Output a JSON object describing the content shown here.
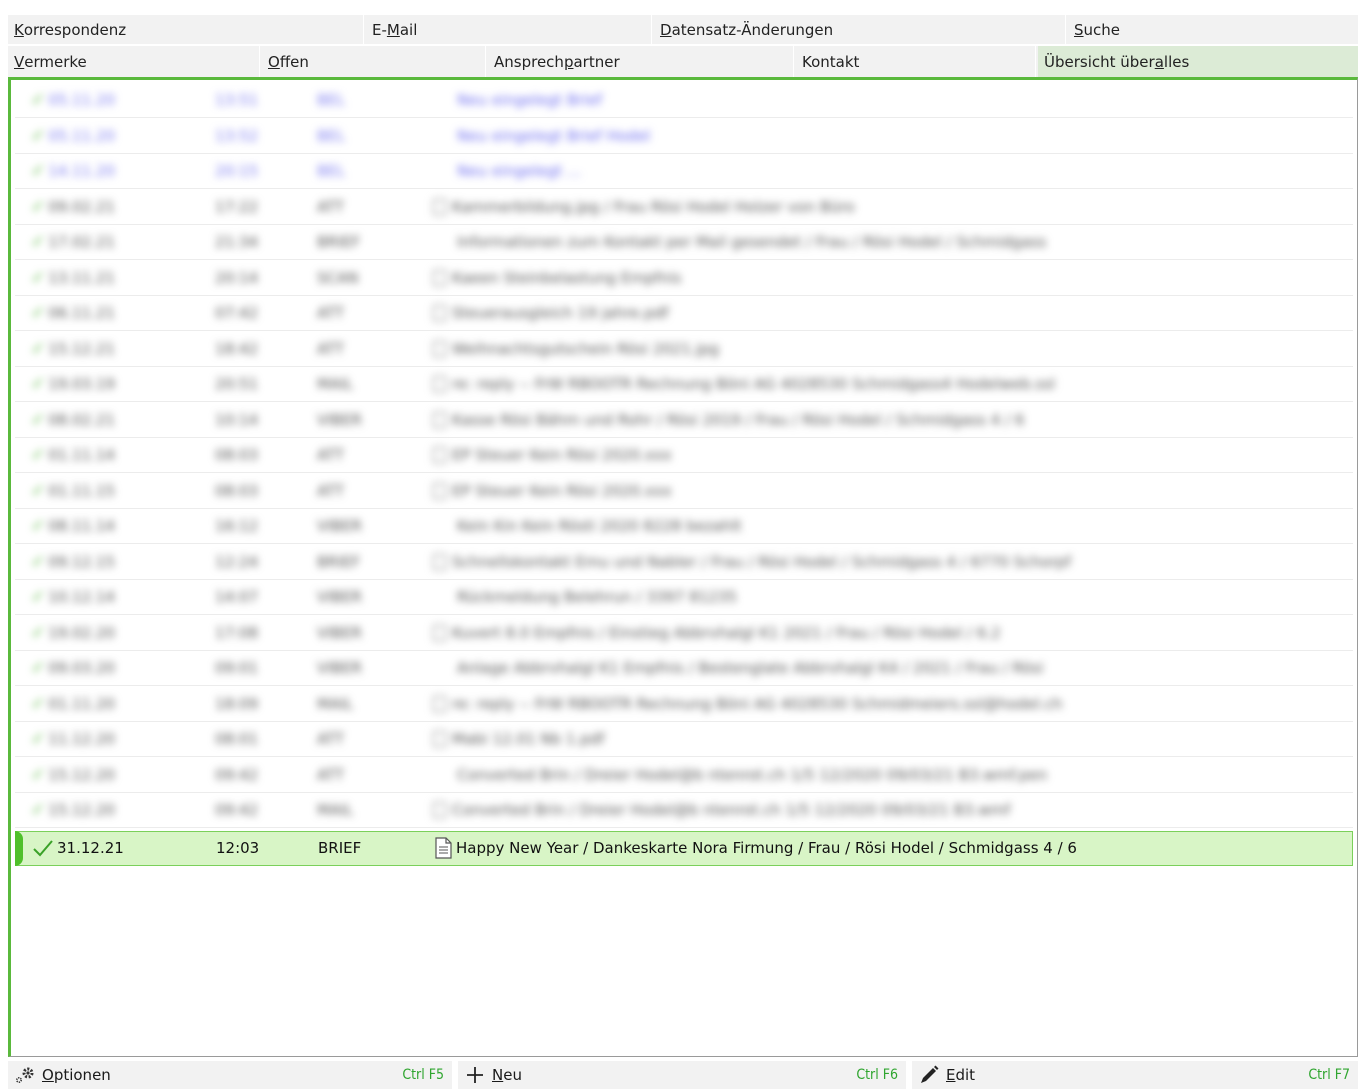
{
  "tabs_row1": [
    {
      "pre": "",
      "u": "K",
      "post": "orrespondenz"
    },
    {
      "pre": "E-",
      "u": "M",
      "post": "ail"
    },
    {
      "pre": "",
      "u": "D",
      "post": "atensatz-Änderungen"
    },
    {
      "pre": "",
      "u": "S",
      "post": "uche"
    }
  ],
  "tabs_row2": [
    {
      "pre": "",
      "u": "V",
      "post": "ermerke"
    },
    {
      "pre": "",
      "u": "O",
      "post": "ffen"
    },
    {
      "pre": "Ansprech",
      "u": "p",
      "post": "artner"
    },
    {
      "pre": "Kontakt",
      "u": "",
      "post": ""
    },
    {
      "pre": "Übersicht über ",
      "u": "a",
      "post": "lles"
    }
  ],
  "rows": [
    {
      "date": "05.11.20",
      "time": "13:51",
      "kind": "BEL",
      "text": "Neu eingelegt Brief",
      "blue": true,
      "doc": false
    },
    {
      "date": "05.11.20",
      "time": "13:52",
      "kind": "BEL",
      "text": "Neu eingelegt Brief Hodel",
      "blue": true,
      "doc": false
    },
    {
      "date": "14.11.20",
      "time": "20:15",
      "kind": "BEL",
      "text": "Neu eingelegt ...",
      "blue": true,
      "doc": false
    },
    {
      "date": "09.02.21",
      "time": "17:22",
      "kind": "ATT",
      "text": "Kammerbildung.jpg / Frau Rösi Hodel Holzer von Büro",
      "blue": false,
      "doc": true
    },
    {
      "date": "17.02.21",
      "time": "21:34",
      "kind": "BRIEF",
      "text": "Informationen zum Kontakt per Mail gesendet / Frau / Rösi Hodel / Schmidgass",
      "blue": false,
      "doc": false
    },
    {
      "date": "13.11.21",
      "time": "20:14",
      "kind": "SCAN",
      "text": "Kaeen Steinbelastung Empfnis",
      "blue": false,
      "doc": true
    },
    {
      "date": "06.11.21",
      "time": "07:42",
      "kind": "ATT",
      "text": "Steuerausgleich 19 jahre.pdf",
      "blue": false,
      "doc": true
    },
    {
      "date": "15.12.21",
      "time": "18:42",
      "kind": "ATT",
      "text": "Weihnachtsgutschein Rösi 2021.jpg",
      "blue": false,
      "doc": true
    },
    {
      "date": "19.03.19",
      "time": "20:51",
      "kind": "MAIL",
      "text": "re: reply -- FrW RBOOTR Rechnung Böni AG 4028530 Schmidgass4 Hodelweb.ssl",
      "blue": false,
      "doc": true
    },
    {
      "date": "08.02.21",
      "time": "10:14",
      "kind": "VIBER",
      "text": "Kasse Rösi Bähm und Rohr / Rösi 2019 / Frau / Rösi Hodel / Schmidgass 4 / 6",
      "blue": false,
      "doc": true
    },
    {
      "date": "01.11.14",
      "time": "08:03",
      "kind": "ATT",
      "text": "EP Steuer Kein Rösi 2020.xxx",
      "blue": false,
      "doc": true
    },
    {
      "date": "01.11.15",
      "time": "08:03",
      "kind": "ATT",
      "text": "EP Steuer Kein Rösi 2020.xxx",
      "blue": false,
      "doc": true
    },
    {
      "date": "08.11.14",
      "time": "16:12",
      "kind": "VIBER",
      "text": "Kein Kin Kein Rösti 2020 8228 bezahlt",
      "blue": false,
      "doc": false
    },
    {
      "date": "09.12.15",
      "time": "12:24",
      "kind": "BRIEF",
      "text": "Schnellskontakt Emu und Nabler / Frau / Rösi Hodel / Schmidgass 4 / 6770 Schorpf",
      "blue": false,
      "doc": true
    },
    {
      "date": "10.12.14",
      "time": "14:07",
      "kind": "VIBER",
      "text": "Rückmeldung Belehrun / 3397 81235",
      "blue": false,
      "doc": false
    },
    {
      "date": "19.02.20",
      "time": "17:08",
      "kind": "VIBER",
      "text": "Kuvert 8.0 Empfnis / Einstieg Abbrvhalgl K1 2021 / Frau / Rösi Hodel / 6.2",
      "blue": false,
      "doc": true
    },
    {
      "date": "09.03.20",
      "time": "09:01",
      "kind": "VIBER",
      "text": "Anlage Abbrvhalgl K1 Empfnis / Bestenglate Abbrvhalgl K4 / 2021 / Frau / Rösi",
      "blue": false,
      "doc": false
    },
    {
      "date": "01.11.20",
      "time": "18:09",
      "kind": "MAIL",
      "text": "re: reply -- FrW RBOOTR Rechnung Böni AG 4028530 Schmidmeiers.ssl@hodel.ch",
      "blue": false,
      "doc": true
    },
    {
      "date": "11.12.20",
      "time": "08:01",
      "kind": "ATT",
      "text": "Mabi 12.01 Nb 1.pdf",
      "blue": false,
      "doc": true
    },
    {
      "date": "15.12.20",
      "time": "09:42",
      "kind": "ATT",
      "text": "Converted Brin / Dreier Hodel@b ntenrot.ch 1/5 12/2020 09/03/21 B3.wmf.pen",
      "blue": false,
      "doc": false
    },
    {
      "date": "15.12.20",
      "time": "09:42",
      "kind": "MAIL",
      "text": "Converted Brin / Dreier Hodel@b ntenrot.ch 1/5 12/2020 09/03/21 B3.wmf",
      "blue": false,
      "doc": true
    }
  ],
  "selected_row": {
    "date": "31.12.21",
    "time": "12:03",
    "kind": "BRIEF",
    "text": "Happy New Year / Dankeskarte Nora Firmung / Frau / Rösi Hodel / Schmidgass 4 / 6"
  },
  "toolbar": {
    "optionen": {
      "u": "O",
      "post": "ptionen",
      "shortcut": "Ctrl F5"
    },
    "neu": {
      "u": "N",
      "post": "eu",
      "shortcut": "Ctrl F6"
    },
    "edit": {
      "u": "E",
      "post": "dit",
      "shortcut": "Ctrl F7"
    }
  },
  "colors": {
    "accent": "#5ab93c",
    "selected_bg": "#d8f5c6",
    "shortcut": "#2fa52f"
  }
}
